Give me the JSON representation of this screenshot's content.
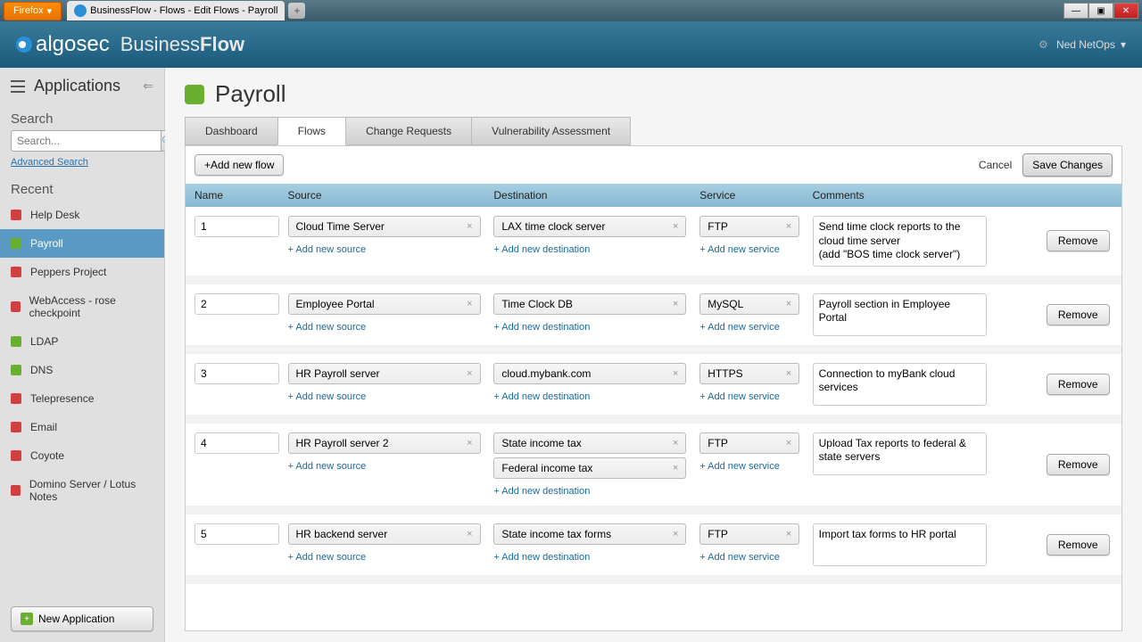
{
  "chrome": {
    "firefox_label": "Firefox",
    "tab_title": "BusinessFlow - Flows - Edit Flows - Payroll"
  },
  "header": {
    "logo_text": "algosec",
    "product_pre": "Business",
    "product_bold": "Flow",
    "user_name": "Ned NetOps"
  },
  "sidebar": {
    "title": "Applications",
    "search_label": "Search",
    "search_placeholder": "Search...",
    "advanced_search": "Advanced Search",
    "recent_label": "Recent",
    "items": [
      {
        "label": "Help Desk",
        "color": "red",
        "active": false
      },
      {
        "label": "Payroll",
        "color": "green",
        "active": true
      },
      {
        "label": "Peppers Project",
        "color": "red",
        "active": false
      },
      {
        "label": "WebAccess - rose checkpoint",
        "color": "red",
        "active": false
      },
      {
        "label": "LDAP",
        "color": "green",
        "active": false
      },
      {
        "label": "DNS",
        "color": "green",
        "active": false
      },
      {
        "label": "Telepresence",
        "color": "red",
        "active": false
      },
      {
        "label": "Email",
        "color": "red",
        "active": false
      },
      {
        "label": "Coyote",
        "color": "red",
        "active": false
      },
      {
        "label": "Domino Server / Lotus Notes",
        "color": "red",
        "active": false
      }
    ],
    "new_app": "New Application"
  },
  "page": {
    "title": "Payroll",
    "tabs": [
      "Dashboard",
      "Flows",
      "Change Requests",
      "Vulnerability Assessment"
    ],
    "active_tab": 1,
    "add_flow": "+Add new flow",
    "cancel": "Cancel",
    "save": "Save Changes",
    "columns": {
      "name": "Name",
      "source": "Source",
      "destination": "Destination",
      "service": "Service",
      "comments": "Comments"
    },
    "add_source": "+ Add new source",
    "add_destination": "+ Add new destination",
    "add_service": "+ Add new service",
    "remove": "Remove",
    "flows": [
      {
        "id": "1",
        "sources": [
          "Cloud Time Server"
        ],
        "destinations": [
          "LAX time clock server"
        ],
        "services": [
          "FTP"
        ],
        "comment": "Send time clock reports to the cloud time server\n(add \"BOS time clock server\")"
      },
      {
        "id": "2",
        "sources": [
          "Employee Portal"
        ],
        "destinations": [
          "Time Clock DB"
        ],
        "services": [
          "MySQL"
        ],
        "comment": "Payroll section in Employee Portal"
      },
      {
        "id": "3",
        "sources": [
          "HR Payroll server"
        ],
        "destinations": [
          "cloud.mybank.com"
        ],
        "services": [
          "HTTPS"
        ],
        "comment": "Connection to myBank cloud services"
      },
      {
        "id": "4",
        "sources": [
          "HR Payroll server 2"
        ],
        "destinations": [
          "State income tax",
          "Federal income tax"
        ],
        "services": [
          "FTP"
        ],
        "comment": "Upload Tax reports to federal & state servers"
      },
      {
        "id": "5",
        "sources": [
          "HR backend server"
        ],
        "destinations": [
          "State income tax forms"
        ],
        "services": [
          "FTP"
        ],
        "comment": "Import tax forms to HR portal"
      }
    ]
  }
}
